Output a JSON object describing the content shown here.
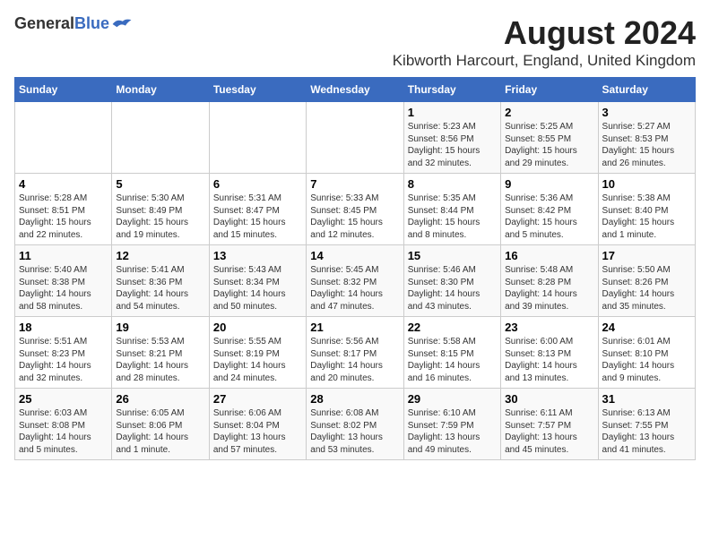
{
  "logo": {
    "general": "General",
    "blue": "Blue"
  },
  "title": "August 2024",
  "subtitle": "Kibworth Harcourt, England, United Kingdom",
  "headers": [
    "Sunday",
    "Monday",
    "Tuesday",
    "Wednesday",
    "Thursday",
    "Friday",
    "Saturday"
  ],
  "weeks": [
    [
      {
        "day": "",
        "content": ""
      },
      {
        "day": "",
        "content": ""
      },
      {
        "day": "",
        "content": ""
      },
      {
        "day": "",
        "content": ""
      },
      {
        "day": "1",
        "content": "Sunrise: 5:23 AM\nSunset: 8:56 PM\nDaylight: 15 hours\nand 32 minutes."
      },
      {
        "day": "2",
        "content": "Sunrise: 5:25 AM\nSunset: 8:55 PM\nDaylight: 15 hours\nand 29 minutes."
      },
      {
        "day": "3",
        "content": "Sunrise: 5:27 AM\nSunset: 8:53 PM\nDaylight: 15 hours\nand 26 minutes."
      }
    ],
    [
      {
        "day": "4",
        "content": "Sunrise: 5:28 AM\nSunset: 8:51 PM\nDaylight: 15 hours\nand 22 minutes."
      },
      {
        "day": "5",
        "content": "Sunrise: 5:30 AM\nSunset: 8:49 PM\nDaylight: 15 hours\nand 19 minutes."
      },
      {
        "day": "6",
        "content": "Sunrise: 5:31 AM\nSunset: 8:47 PM\nDaylight: 15 hours\nand 15 minutes."
      },
      {
        "day": "7",
        "content": "Sunrise: 5:33 AM\nSunset: 8:45 PM\nDaylight: 15 hours\nand 12 minutes."
      },
      {
        "day": "8",
        "content": "Sunrise: 5:35 AM\nSunset: 8:44 PM\nDaylight: 15 hours\nand 8 minutes."
      },
      {
        "day": "9",
        "content": "Sunrise: 5:36 AM\nSunset: 8:42 PM\nDaylight: 15 hours\nand 5 minutes."
      },
      {
        "day": "10",
        "content": "Sunrise: 5:38 AM\nSunset: 8:40 PM\nDaylight: 15 hours\nand 1 minute."
      }
    ],
    [
      {
        "day": "11",
        "content": "Sunrise: 5:40 AM\nSunset: 8:38 PM\nDaylight: 14 hours\nand 58 minutes."
      },
      {
        "day": "12",
        "content": "Sunrise: 5:41 AM\nSunset: 8:36 PM\nDaylight: 14 hours\nand 54 minutes."
      },
      {
        "day": "13",
        "content": "Sunrise: 5:43 AM\nSunset: 8:34 PM\nDaylight: 14 hours\nand 50 minutes."
      },
      {
        "day": "14",
        "content": "Sunrise: 5:45 AM\nSunset: 8:32 PM\nDaylight: 14 hours\nand 47 minutes."
      },
      {
        "day": "15",
        "content": "Sunrise: 5:46 AM\nSunset: 8:30 PM\nDaylight: 14 hours\nand 43 minutes."
      },
      {
        "day": "16",
        "content": "Sunrise: 5:48 AM\nSunset: 8:28 PM\nDaylight: 14 hours\nand 39 minutes."
      },
      {
        "day": "17",
        "content": "Sunrise: 5:50 AM\nSunset: 8:26 PM\nDaylight: 14 hours\nand 35 minutes."
      }
    ],
    [
      {
        "day": "18",
        "content": "Sunrise: 5:51 AM\nSunset: 8:23 PM\nDaylight: 14 hours\nand 32 minutes."
      },
      {
        "day": "19",
        "content": "Sunrise: 5:53 AM\nSunset: 8:21 PM\nDaylight: 14 hours\nand 28 minutes."
      },
      {
        "day": "20",
        "content": "Sunrise: 5:55 AM\nSunset: 8:19 PM\nDaylight: 14 hours\nand 24 minutes."
      },
      {
        "day": "21",
        "content": "Sunrise: 5:56 AM\nSunset: 8:17 PM\nDaylight: 14 hours\nand 20 minutes."
      },
      {
        "day": "22",
        "content": "Sunrise: 5:58 AM\nSunset: 8:15 PM\nDaylight: 14 hours\nand 16 minutes."
      },
      {
        "day": "23",
        "content": "Sunrise: 6:00 AM\nSunset: 8:13 PM\nDaylight: 14 hours\nand 13 minutes."
      },
      {
        "day": "24",
        "content": "Sunrise: 6:01 AM\nSunset: 8:10 PM\nDaylight: 14 hours\nand 9 minutes."
      }
    ],
    [
      {
        "day": "25",
        "content": "Sunrise: 6:03 AM\nSunset: 8:08 PM\nDaylight: 14 hours\nand 5 minutes."
      },
      {
        "day": "26",
        "content": "Sunrise: 6:05 AM\nSunset: 8:06 PM\nDaylight: 14 hours\nand 1 minute."
      },
      {
        "day": "27",
        "content": "Sunrise: 6:06 AM\nSunset: 8:04 PM\nDaylight: 13 hours\nand 57 minutes."
      },
      {
        "day": "28",
        "content": "Sunrise: 6:08 AM\nSunset: 8:02 PM\nDaylight: 13 hours\nand 53 minutes."
      },
      {
        "day": "29",
        "content": "Sunrise: 6:10 AM\nSunset: 7:59 PM\nDaylight: 13 hours\nand 49 minutes."
      },
      {
        "day": "30",
        "content": "Sunrise: 6:11 AM\nSunset: 7:57 PM\nDaylight: 13 hours\nand 45 minutes."
      },
      {
        "day": "31",
        "content": "Sunrise: 6:13 AM\nSunset: 7:55 PM\nDaylight: 13 hours\nand 41 minutes."
      }
    ]
  ]
}
